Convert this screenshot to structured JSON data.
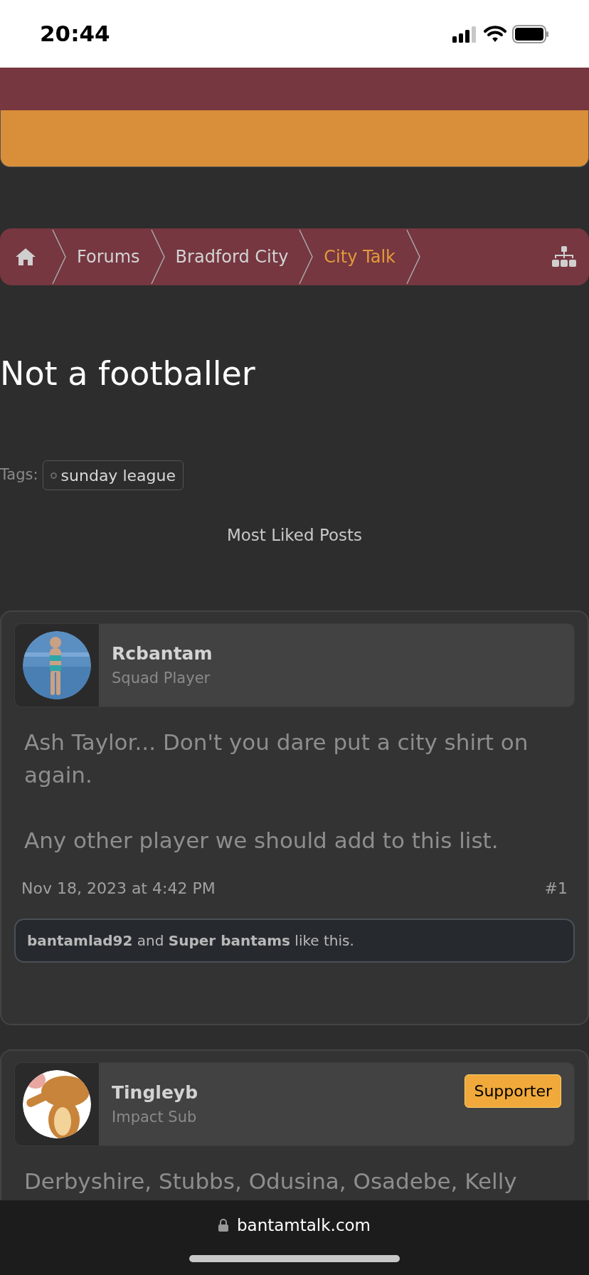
{
  "status_bar": {
    "time": "20:44"
  },
  "breadcrumbs": [
    {
      "label": "Forums",
      "selected": false
    },
    {
      "label": "Bradford City",
      "selected": false
    },
    {
      "label": "City Talk",
      "selected": true
    }
  ],
  "title": "Not a footballer",
  "tags": {
    "label": "Tags:",
    "items": [
      "sunday league"
    ]
  },
  "most_liked": "Most Liked Posts",
  "posts": [
    {
      "user": "Rcbantam",
      "role": "Squad Player",
      "avatar": {
        "kind": "picture"
      },
      "paragraphs": [
        "Ash Taylor... Don't you dare put a city shirt on again.",
        "Any other player we should add to this list."
      ],
      "date": "Nov 18, 2023 at 4:42 PM",
      "number": "#1",
      "likes": "**bantamlad92** and **Super bantams** like this."
    },
    {
      "user": "Tingleyb",
      "role": "Impact Sub",
      "badge": "Supporter",
      "avatar": {
        "kind": "picture"
      },
      "paragraphs": [
        "Derbyshire, Stubbs, Odusina, Osadebe, Kelly"
      ]
    }
  ],
  "browser": {
    "url": "bantamtalk.com"
  }
}
